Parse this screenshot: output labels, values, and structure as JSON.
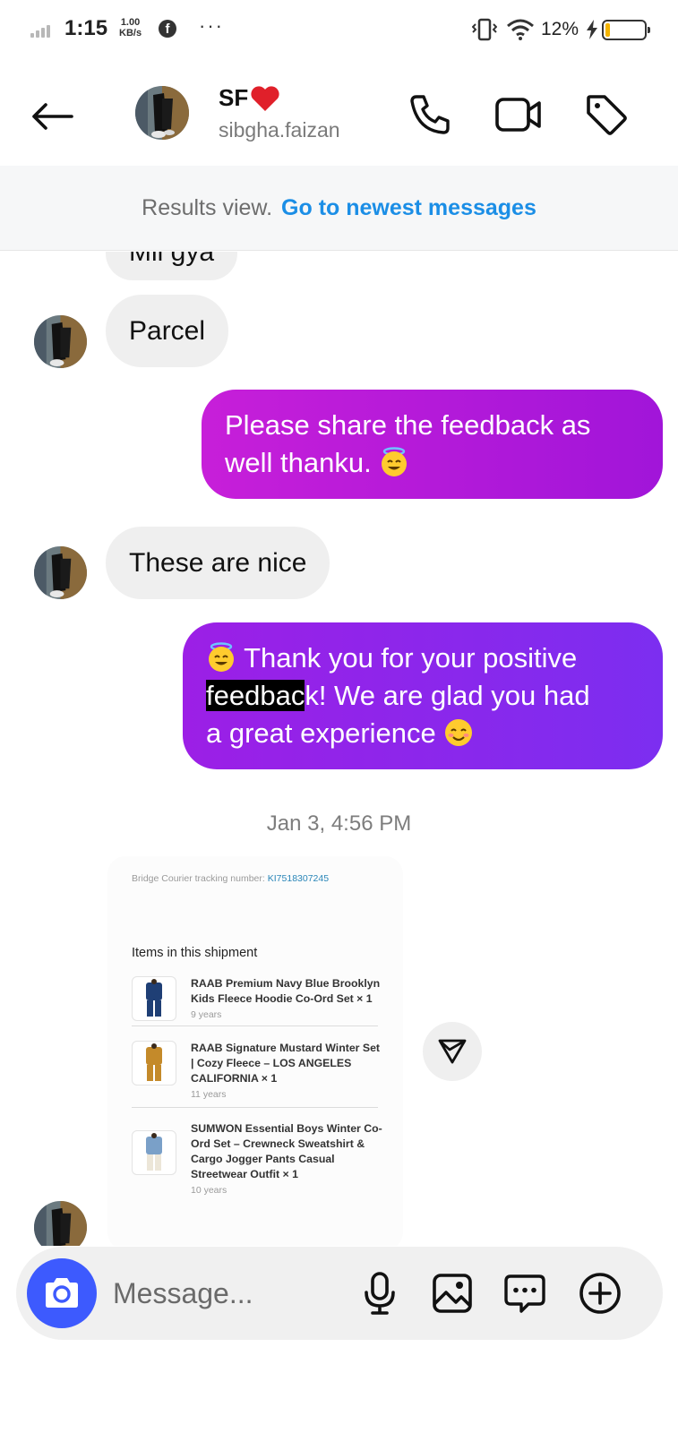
{
  "status_bar": {
    "time": "1:15",
    "speed_value": "1.00",
    "speed_unit": "KB/s",
    "notification_app": "f",
    "more": "···",
    "battery_percent": "12%",
    "battery_level": 0.12,
    "battery_color": "#f4b400"
  },
  "header": {
    "name": "SF",
    "name_emoji": "red-heart-icon",
    "username": "sibgha.faizan"
  },
  "results_banner": {
    "label": "Results view.",
    "link": "Go to newest messages"
  },
  "messages": [
    {
      "id": "m1",
      "direction": "incoming",
      "text": "Mil gya"
    },
    {
      "id": "m2",
      "direction": "incoming",
      "text": "Parcel"
    },
    {
      "id": "m3",
      "direction": "outgoing",
      "line1": "Please share the feedback as",
      "line2": "well thanku.",
      "emoji": "smiling-halo-emoji"
    },
    {
      "id": "m4",
      "direction": "incoming",
      "text": "These are nice"
    },
    {
      "id": "m5",
      "direction": "outgoing",
      "lead_emoji": "smiling-halo-emoji",
      "line1": "Thank you for your positive",
      "highlighted": "feedbac",
      "line2_rest": "k! We are glad you had",
      "line3": "a great experience",
      "end_emoji": "smiling-blush-emoji"
    }
  ],
  "timestamp": "Jan 3, 4:56 PM",
  "shipment": {
    "tracking_label": "Bridge Courier tracking number:",
    "tracking_number": "KI7518307245",
    "items_title": "Items in this shipment",
    "items": [
      {
        "name": "RAAB Premium Navy Blue Brooklyn Kids Fleece Hoodie Co-Ord Set × 1",
        "age": "9 years",
        "color": "#1f3f75"
      },
      {
        "name": "RAAB Signature Mustard Winter Set | Cozy Fleece – LOS ANGELES CALIFORNIA × 1",
        "age": "11 years",
        "color": "#c48a2a"
      },
      {
        "name": "SUMWON Essential Boys Winter Co-Ord Set – Crewneck Sweatshirt & Cargo Jogger Pants Casual Streetwear Outfit × 1",
        "age": "10 years",
        "color": "#7aa0c8"
      }
    ]
  },
  "composer": {
    "placeholder": "Message..."
  },
  "colors": {
    "accent_link": "#1b8ee6",
    "camera_button": "#3d5afe",
    "bubble_out_1_start": "#c71fd9",
    "bubble_out_1_end": "#a115d9",
    "bubble_out_2_start": "#9c1fe6",
    "bubble_out_2_end": "#7c2ef0",
    "bubble_in": "#efefef"
  }
}
